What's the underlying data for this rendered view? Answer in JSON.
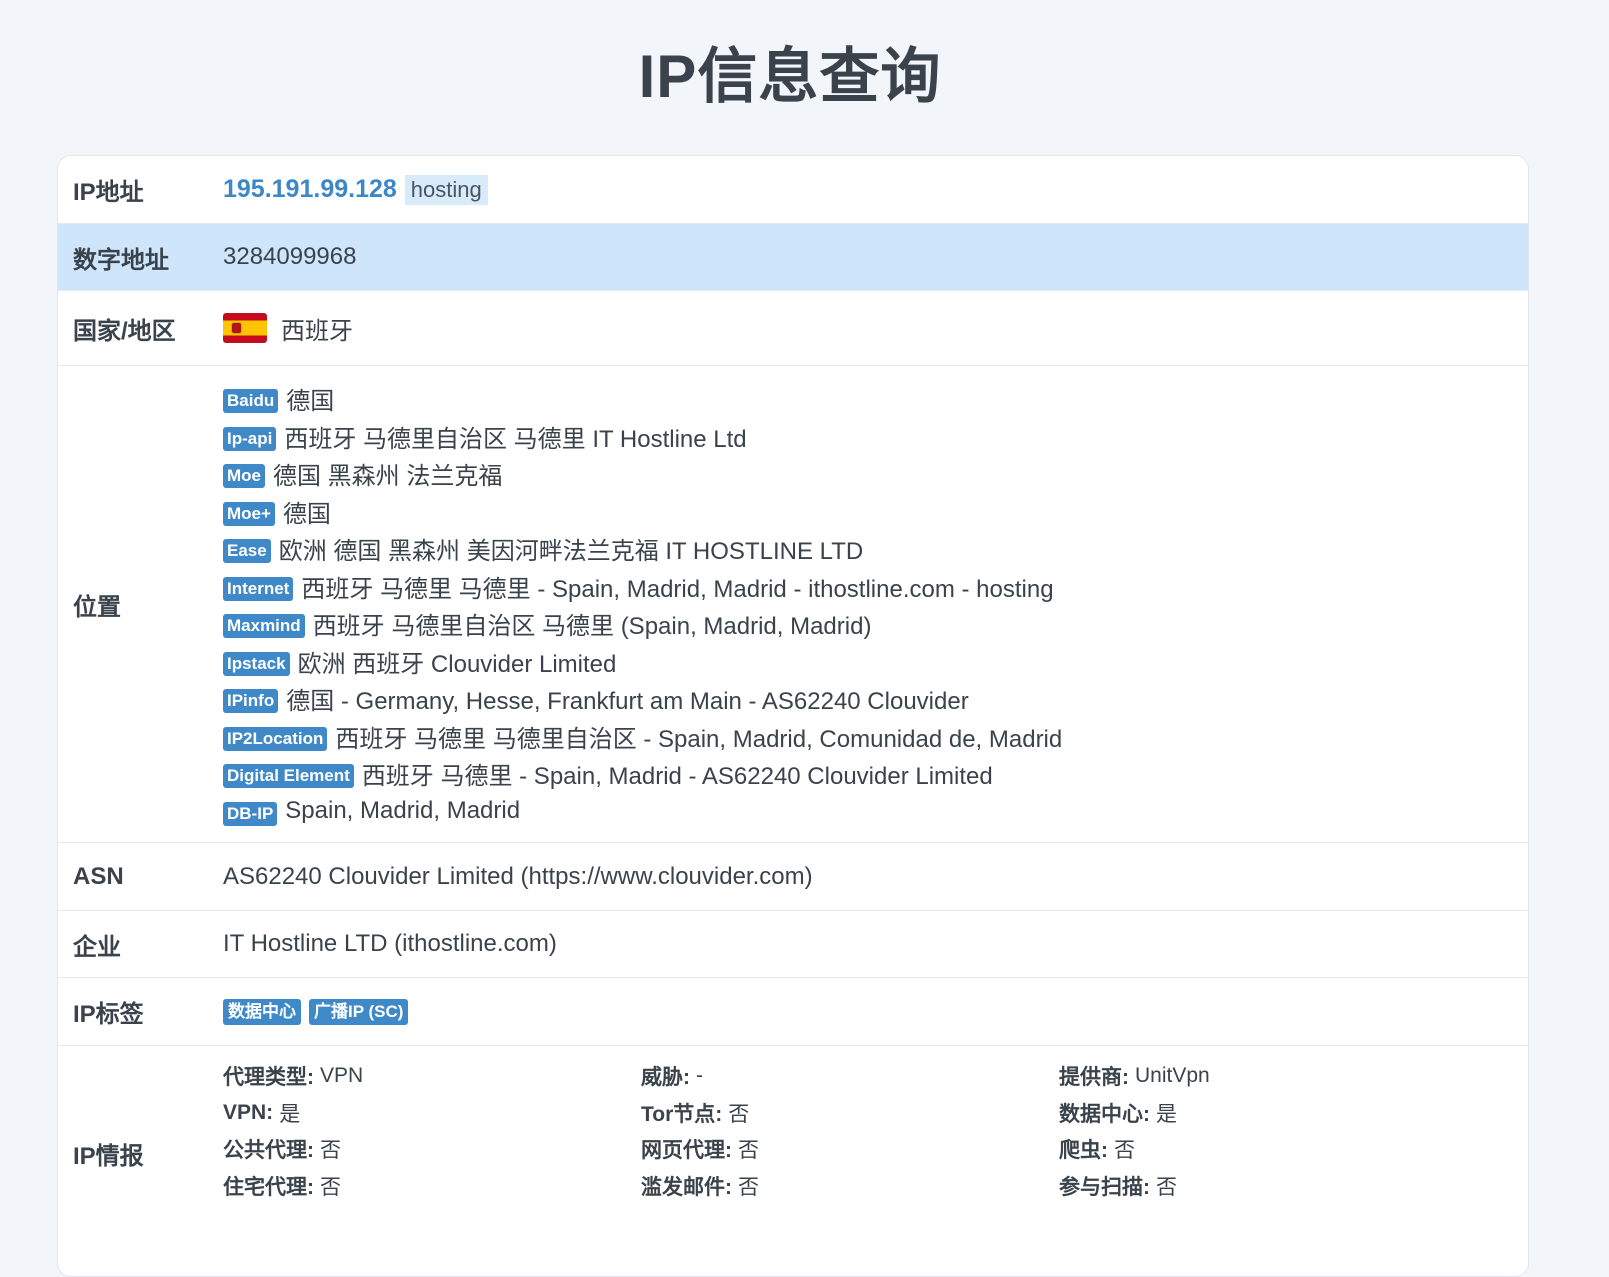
{
  "page": {
    "title": "IP信息查询"
  },
  "rows": {
    "ip": {
      "label": "IP地址",
      "value": "195.191.99.128",
      "tag": "hosting"
    },
    "numeric": {
      "label": "数字地址",
      "value": "3284099968"
    },
    "country": {
      "label": "国家/地区",
      "flag_icon": "spain-flag-icon",
      "value": "西班牙"
    },
    "location": {
      "label": "位置",
      "items": [
        {
          "source": "Baidu",
          "text": "德国"
        },
        {
          "source": "Ip-api",
          "text": "西班牙 马德里自治区 马德里 IT Hostline Ltd"
        },
        {
          "source": "Moe",
          "text": "德国 黑森州 法兰克福"
        },
        {
          "source": "Moe+",
          "text": "德国"
        },
        {
          "source": "Ease",
          "text": "欧洲 德国 黑森州 美因河畔法兰克福 IT HOSTLINE LTD"
        },
        {
          "source": "Internet",
          "text": "西班牙 马德里 马德里 - Spain, Madrid, Madrid - ithostline.com - hosting"
        },
        {
          "source": "Maxmind",
          "text": "西班牙 马德里自治区 马德里 (Spain, Madrid, Madrid)"
        },
        {
          "source": "Ipstack",
          "text": "欧洲 西班牙 Clouvider Limited"
        },
        {
          "source": "IPinfo",
          "text": "德国 - Germany, Hesse, Frankfurt am Main - AS62240 Clouvider"
        },
        {
          "source": "IP2Location",
          "text": "西班牙 马德里 马德里自治区 - Spain, Madrid, Comunidad de, Madrid"
        },
        {
          "source": "Digital Element",
          "text": "西班牙 马德里 - Spain, Madrid - AS62240 Clouvider Limited"
        },
        {
          "source": "DB-IP",
          "text": "Spain, Madrid, Madrid"
        }
      ]
    },
    "asn": {
      "label": "ASN",
      "value": "AS62240 Clouvider Limited (https://www.clouvider.com)"
    },
    "company": {
      "label": "企业",
      "value": "IT Hostline LTD (ithostline.com)"
    },
    "tags": {
      "label": "IP标签",
      "items": [
        "数据中心",
        "广播IP (SC)"
      ]
    },
    "intel": {
      "label": "IP情报",
      "items": [
        {
          "key": "代理类型:",
          "value": "VPN"
        },
        {
          "key": "威胁:",
          "value": "-"
        },
        {
          "key": "提供商:",
          "value": "UnitVpn"
        },
        {
          "key": "VPN:",
          "value": "是"
        },
        {
          "key": "Tor节点:",
          "value": "否"
        },
        {
          "key": "数据中心:",
          "value": "是"
        },
        {
          "key": "公共代理:",
          "value": "否"
        },
        {
          "key": "网页代理:",
          "value": "否"
        },
        {
          "key": "爬虫:",
          "value": "否"
        },
        {
          "key": "住宅代理:",
          "value": "否"
        },
        {
          "key": "滥发邮件:",
          "value": "否"
        },
        {
          "key": "参与扫描:",
          "value": "否"
        }
      ]
    }
  }
}
